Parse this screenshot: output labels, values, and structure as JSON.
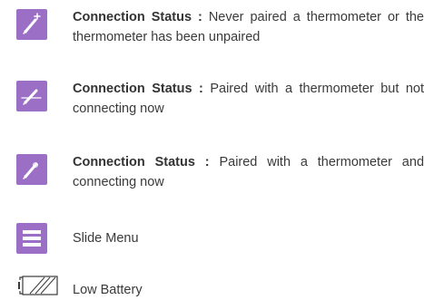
{
  "accent_color": "#9b6fc6",
  "items": [
    {
      "icon": "thermometer-plus-icon",
      "label": "Connection Status :",
      "text": "Never paired a thermometer or the thermometer has been unpaired"
    },
    {
      "icon": "thermometer-disconnected-icon",
      "label": "Connection Status :",
      "text": "Paired with a thermometer but not connecting now"
    },
    {
      "icon": "thermometer-connected-icon",
      "label": "Connection Status :",
      "text": "Paired with a thermometer and connecting now"
    },
    {
      "icon": "menu-icon",
      "text": "Slide Menu"
    },
    {
      "icon": "low-battery-icon",
      "text": "Low Battery"
    }
  ]
}
